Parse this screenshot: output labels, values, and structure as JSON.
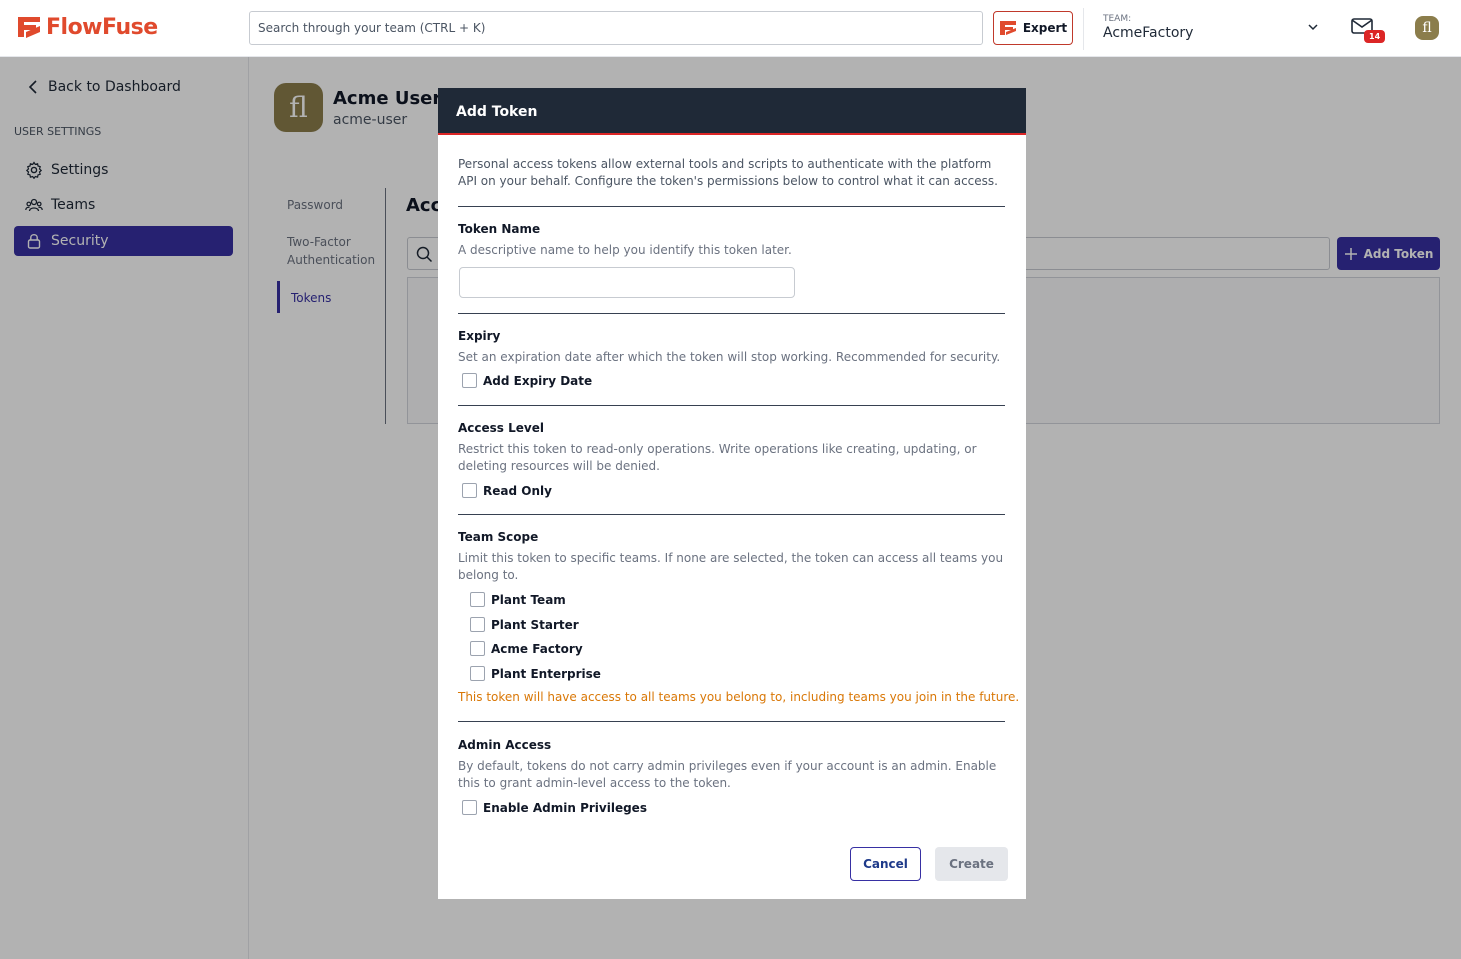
{
  "header": {
    "logo_text": "FlowFuse",
    "search_placeholder": "Search through your team (CTRL + K)",
    "expert_label": "Expert",
    "team_caption": "TEAM:",
    "team_name": "AcmeFactory",
    "inbox_count": "14",
    "avatar_initials": "fl",
    "brand_color": "#e04a2d"
  },
  "sidebar": {
    "back_label": "Back to Dashboard",
    "section_caption": "USER SETTINGS",
    "items": [
      {
        "label": "Settings",
        "icon": "gear-icon"
      },
      {
        "label": "Teams",
        "icon": "users-icon"
      },
      {
        "label": "Security",
        "icon": "lock-icon",
        "active": true
      }
    ],
    "accent_color": "#3730a3"
  },
  "profile": {
    "avatar_initials": "fl",
    "name": "Acme User",
    "username": "acme-user"
  },
  "subnav": {
    "items": [
      "Password",
      "Two-Factor Authentication",
      "Tokens"
    ],
    "active": "Tokens"
  },
  "main": {
    "section_title": "Acc",
    "add_token_label": "Add Token"
  },
  "dialog": {
    "title": "Add Token",
    "intro": "Personal access tokens allow external tools and scripts to authenticate with the platform API on your behalf. Configure the token's permissions below to control what it can access.",
    "token_name": {
      "label": "Token Name",
      "description": "A descriptive name to help you identify this token later.",
      "value": ""
    },
    "expiry": {
      "label": "Expiry",
      "description": "Set an expiration date after which the token will stop working. Recommended for security.",
      "checkbox_label": "Add Expiry Date",
      "checked": false
    },
    "access_level": {
      "label": "Access Level",
      "description": "Restrict this token to read-only operations. Write operations like creating, updating, or deleting resources will be denied.",
      "checkbox_label": "Read Only",
      "checked": false
    },
    "team_scope": {
      "label": "Team Scope",
      "description": "Limit this token to specific teams. If none are selected, the token can access all teams you belong to.",
      "teams": [
        "Plant Team",
        "Plant Starter",
        "Acme Factory",
        "Plant Enterprise"
      ],
      "warning": "This token will have access to all teams you belong to, including teams you join in the future."
    },
    "admin_access": {
      "label": "Admin Access",
      "description": "By default, tokens do not carry admin privileges even if your account is an admin. Enable this to grant admin-level access to the token.",
      "checkbox_label": "Enable Admin Privileges",
      "checked": false
    },
    "cancel_label": "Cancel",
    "create_label": "Create"
  }
}
